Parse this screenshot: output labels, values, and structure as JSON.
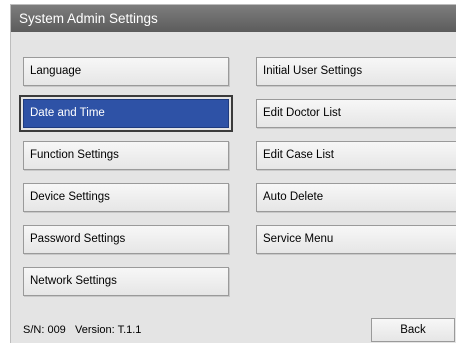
{
  "window": {
    "title": "System Admin Settings"
  },
  "menu": {
    "left": [
      {
        "label": "Language",
        "selected": false
      },
      {
        "label": "Date and Time",
        "selected": true
      },
      {
        "label": "Function Settings",
        "selected": false
      },
      {
        "label": "Device Settings",
        "selected": false
      },
      {
        "label": "Password Settings",
        "selected": false
      },
      {
        "label": "Network Settings",
        "selected": false
      }
    ],
    "right": [
      {
        "label": "Initial User Settings"
      },
      {
        "label": "Edit Doctor List"
      },
      {
        "label": "Edit Case List"
      },
      {
        "label": "Auto Delete"
      },
      {
        "label": "Service Menu"
      }
    ]
  },
  "footer": {
    "serial": "S/N: 009   Version: T.1.1",
    "back_label": "Back"
  },
  "colors": {
    "selected": "#2e52a6",
    "titlebar": "#6a6a6a"
  }
}
